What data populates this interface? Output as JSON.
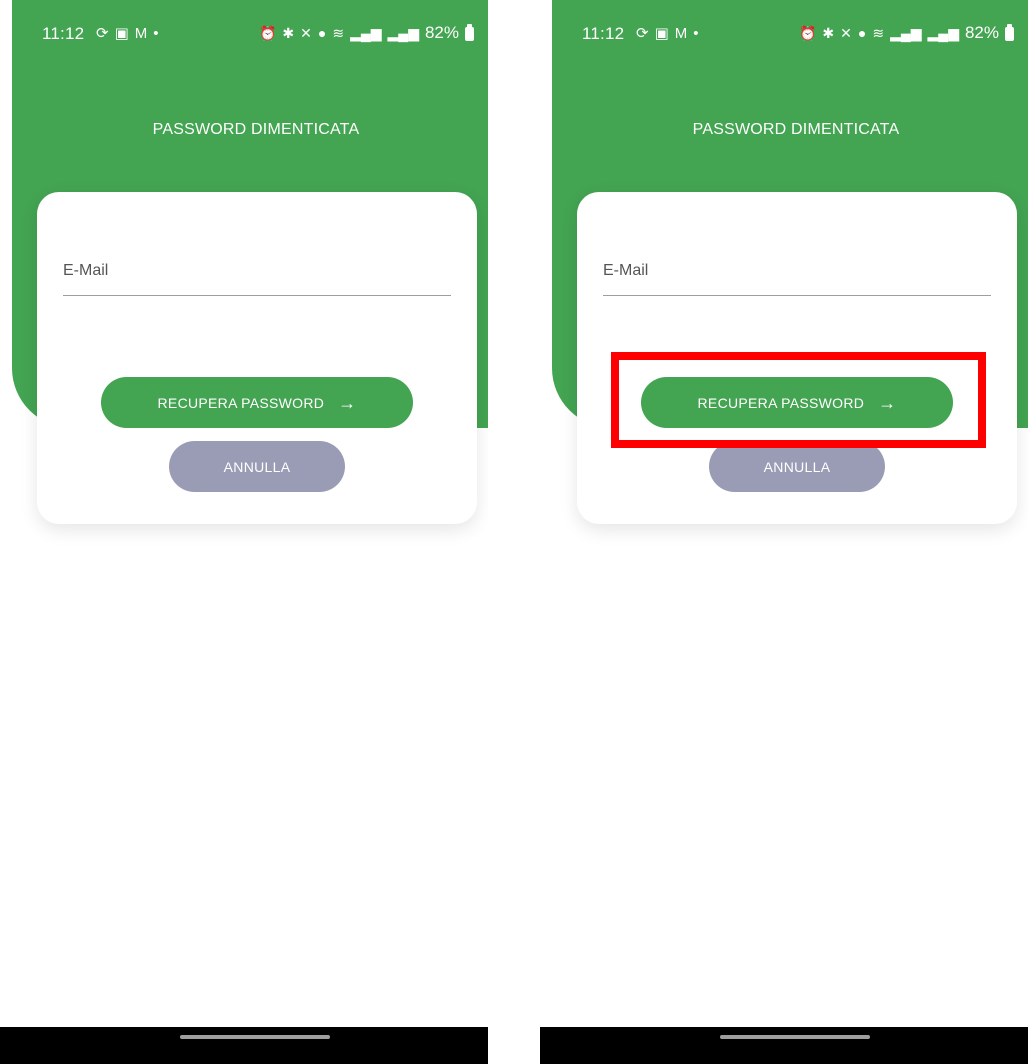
{
  "screens": [
    {
      "status_bar": {
        "time": "11:12",
        "battery": "82%"
      },
      "title": "PASSWORD DIMENTICATA",
      "email_label": "E-Mail",
      "primary_button": "RECUPERA PASSWORD",
      "primary_button_icon": "→",
      "secondary_button": "ANNULLA"
    },
    {
      "status_bar": {
        "time": "11:12",
        "battery": "82%"
      },
      "title": "PASSWORD DIMENTICATA",
      "email_label": "E-Mail",
      "primary_button": "RECUPERA PASSWORD",
      "primary_button_icon": "→",
      "secondary_button": "ANNULLA"
    }
  ],
  "colors": {
    "header_green": "#43a452",
    "primary_button": "#43a452",
    "secondary_button": "#9a9cb5",
    "highlight": "#ff0000"
  },
  "icons": {
    "status_left": [
      "sync-icon",
      "gallery-icon",
      "gmail-icon",
      "dot-icon"
    ],
    "status_right": [
      "alarm-icon",
      "bluetooth-icon",
      "mute-icon",
      "location-icon",
      "wifi-icon",
      "signal-icon",
      "signal-icon",
      "battery-icon"
    ]
  }
}
